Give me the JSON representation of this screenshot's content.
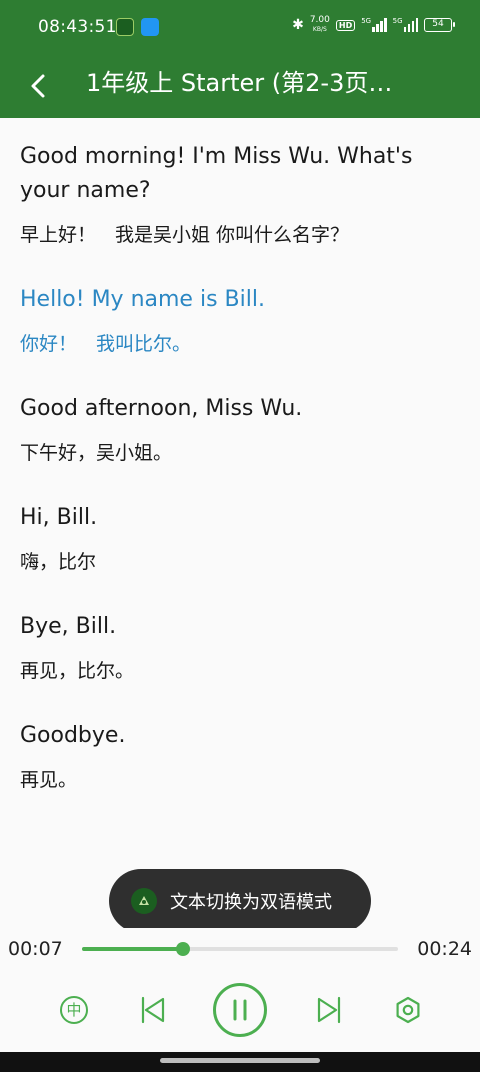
{
  "status_bar": {
    "time": "08:43:51",
    "speed_value": "7.00",
    "speed_unit": "KB/S",
    "hd_label": "HD",
    "signal1_label": "5G",
    "signal2_label": "5G",
    "battery": "54"
  },
  "app_bar": {
    "title": "1年级上 Starter (第2-3页…"
  },
  "transcript": [
    {
      "en": "Good morning! I'm Miss Wu. What's your name?",
      "zh": "早上好！　我是吴小姐 你叫什么名字？",
      "active": false
    },
    {
      "en": "Hello! My name is Bill.",
      "zh": "你好！　我叫比尔。",
      "active": true
    },
    {
      "en": "Good afternoon, Miss Wu.",
      "zh": "下午好，吴小姐。",
      "active": false
    },
    {
      "en": "Hi, Bill.",
      "zh": "嗨，比尔",
      "active": false
    },
    {
      "en": "Bye, Bill.",
      "zh": "再见，比尔。",
      "active": false
    },
    {
      "en": "Goodbye.",
      "zh": "再见。",
      "active": false
    }
  ],
  "toast": {
    "text": "文本切换为双语模式"
  },
  "player": {
    "current_time": "00:07",
    "total_time": "00:24",
    "progress": 0.32,
    "chinese_toggle_label": "中"
  },
  "colors": {
    "brand_green": "#2e7d32",
    "control_green": "#4caf50",
    "active_text": "#2b87c3"
  }
}
